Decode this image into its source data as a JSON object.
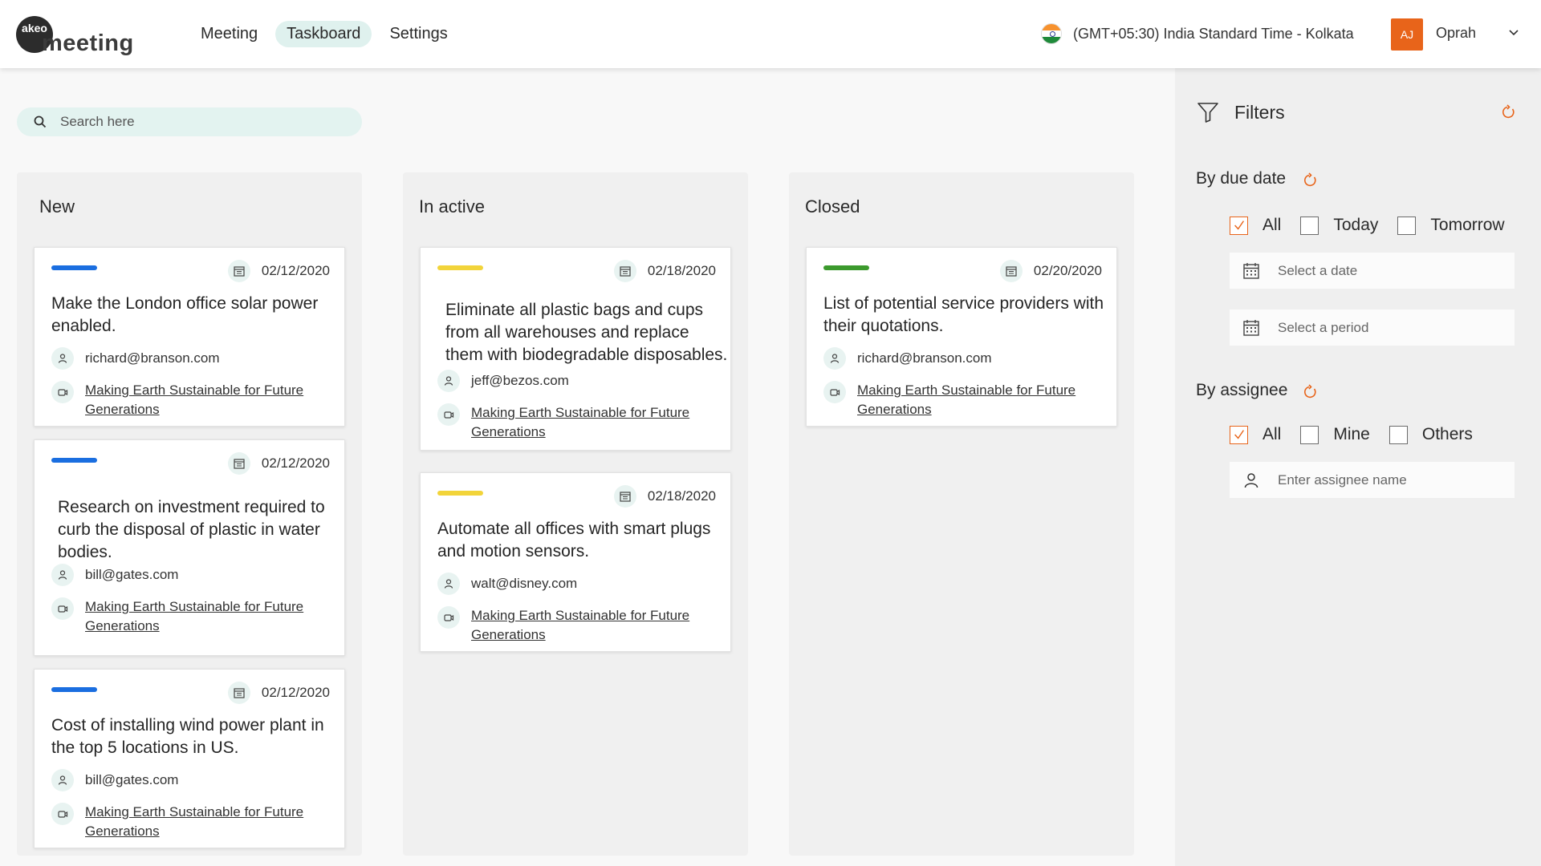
{
  "header": {
    "logo_top": "akeo",
    "logo_word": "meeting",
    "nav": [
      {
        "label": "Meeting",
        "active": false
      },
      {
        "label": "Taskboard",
        "active": true
      },
      {
        "label": "Settings",
        "active": false
      }
    ],
    "timezone": "(GMT+05:30) India Standard Time - Kolkata",
    "user_initials": "AJ",
    "user_name": "Oprah"
  },
  "search": {
    "placeholder": "Search here"
  },
  "columns": [
    {
      "title": "New",
      "cards": [
        {
          "priority_color": "#1a6ee0",
          "date": "02/12/2020",
          "title": "Make the London office solar power enabled.",
          "assignee": "richard@branson.com",
          "meeting": "Making Earth Sustainable for Future Generations"
        },
        {
          "priority_color": "#1a6ee0",
          "date": "02/12/2020",
          "title": "Research on investment required to curb the disposal of plastic in water bodies.",
          "assignee": "bill@gates.com",
          "meeting": "Making Earth Sustainable for Future Generations"
        },
        {
          "priority_color": "#1a6ee0",
          "date": "02/12/2020",
          "title": "Cost of installing wind power plant in the top 5 locations in US.",
          "assignee": "bill@gates.com",
          "meeting": "Making Earth Sustainable for Future Generations"
        }
      ]
    },
    {
      "title": "In active",
      "cards": [
        {
          "priority_color": "#f2d43a",
          "date": "02/18/2020",
          "title": "Eliminate all plastic bags and cups from all warehouses and replace them with biodegradable disposables.",
          "assignee": "jeff@bezos.com",
          "meeting": "Making Earth Sustainable for Future Generations"
        },
        {
          "priority_color": "#f2d43a",
          "date": "02/18/2020",
          "title": "Automate all offices with smart plugs and motion sensors.",
          "assignee": "walt@disney.com",
          "meeting": "Making Earth Sustainable for Future Generations"
        }
      ]
    },
    {
      "title": "Closed",
      "cards": [
        {
          "priority_color": "#3c9a2d",
          "date": "02/20/2020",
          "title": "List of potential service providers with their quotations.",
          "assignee": "richard@branson.com",
          "meeting": "Making Earth Sustainable for Future Generations"
        }
      ]
    }
  ],
  "filters": {
    "title": "Filters",
    "due_date": {
      "label": "By due date",
      "options": [
        {
          "label": "All",
          "checked": true
        },
        {
          "label": "Today",
          "checked": false
        },
        {
          "label": "Tomorrow",
          "checked": false
        }
      ],
      "date_placeholder": "Select a date",
      "period_placeholder": "Select a period"
    },
    "assignee": {
      "label": "By assignee",
      "options": [
        {
          "label": "All",
          "checked": true
        },
        {
          "label": "Mine",
          "checked": false
        },
        {
          "label": "Others",
          "checked": false
        }
      ],
      "name_placeholder": "Enter assignee name"
    }
  },
  "colors": {
    "accent": "#e8641a",
    "nav_active_bg": "#dff1ee",
    "icon_bg": "#e8f3f1"
  }
}
